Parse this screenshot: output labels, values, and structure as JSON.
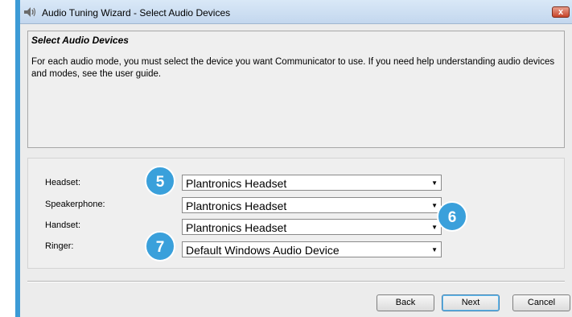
{
  "window": {
    "title": "Audio Tuning Wizard - Select Audio Devices",
    "close_label": "x"
  },
  "header": {
    "title": "Select Audio Devices",
    "description": "For each audio mode, you must select the device you want Communicator to use. If you need help understanding audio devices and modes, see the user guide."
  },
  "devices": {
    "rows": [
      {
        "label": "Headset:",
        "value": "Plantronics Headset"
      },
      {
        "label": "Speakerphone:",
        "value": "Plantronics Headset"
      },
      {
        "label": "Handset:",
        "value": "Plantronics Headset"
      },
      {
        "label": "Ringer:",
        "value": "Default Windows Audio Device"
      }
    ]
  },
  "callouts": [
    "5",
    "6",
    "7"
  ],
  "buttons": {
    "back": "Back",
    "next": "Next",
    "cancel": "Cancel"
  },
  "colors": {
    "accent": "#3aa0db",
    "window_border": "#3c9bd6"
  }
}
